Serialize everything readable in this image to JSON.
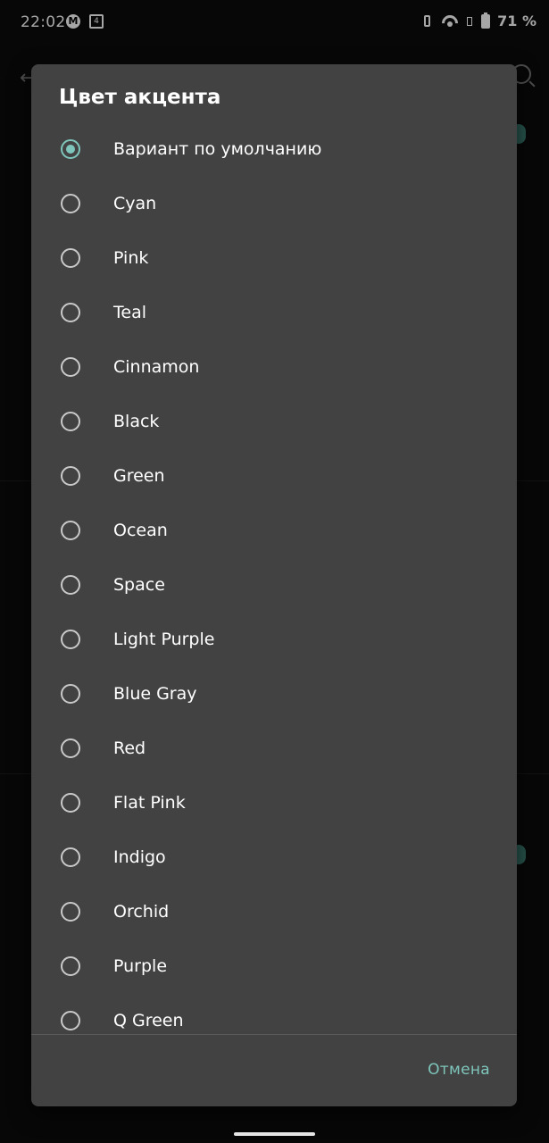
{
  "status_bar": {
    "time": "22:02",
    "notif_m": "M",
    "notif_sq": "4",
    "battery": "71 %"
  },
  "dialog": {
    "title": "Цвет акцента",
    "options": [
      {
        "label": "Вариант по умолчанию",
        "selected": true
      },
      {
        "label": "Cyan",
        "selected": false
      },
      {
        "label": "Pink",
        "selected": false
      },
      {
        "label": "Teal",
        "selected": false
      },
      {
        "label": "Cinnamon",
        "selected": false
      },
      {
        "label": "Black",
        "selected": false
      },
      {
        "label": "Green",
        "selected": false
      },
      {
        "label": "Ocean",
        "selected": false
      },
      {
        "label": "Space",
        "selected": false
      },
      {
        "label": "Light Purple",
        "selected": false
      },
      {
        "label": "Blue Gray",
        "selected": false
      },
      {
        "label": "Red",
        "selected": false
      },
      {
        "label": "Flat Pink",
        "selected": false
      },
      {
        "label": "Indigo",
        "selected": false
      },
      {
        "label": "Orchid",
        "selected": false
      },
      {
        "label": "Purple",
        "selected": false
      },
      {
        "label": "Q Green",
        "selected": false
      }
    ],
    "cancel_label": "Отмена"
  },
  "colors": {
    "accent": "#7ec6bb",
    "dialog_bg": "#424242"
  }
}
